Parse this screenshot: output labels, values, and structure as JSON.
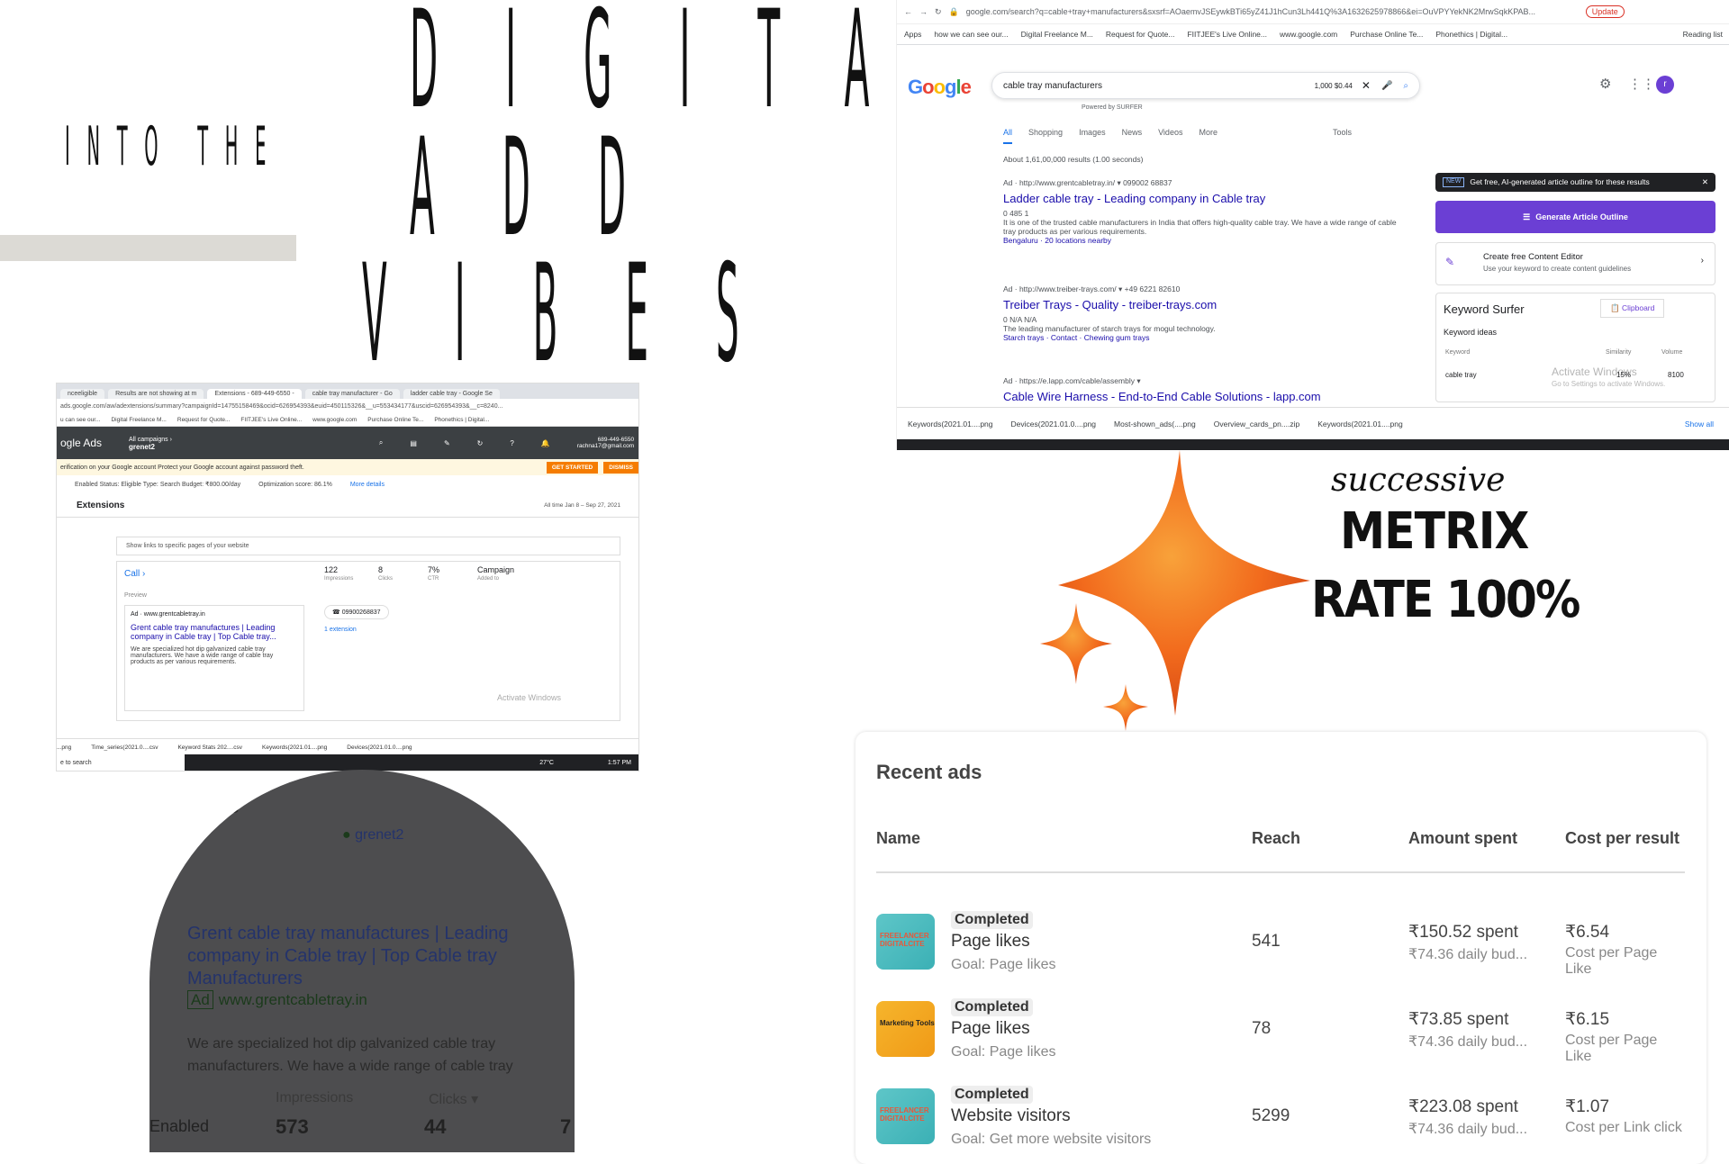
{
  "title": {
    "into": "INTO THE",
    "digital": "DIGITAL",
    "add": "ADD",
    "vibes": "VIBES"
  },
  "google": {
    "url": "google.com/search?q=cable+tray+manufacturers&sxsrf=AOaemvJSEywkBTi65yZ41J1hCun3Lh441Q%3A1632625978866&ei=OuVPYYekNK2MrwSqkKPAB...",
    "bookmarks": [
      "Apps",
      "how we can see our...",
      "Digital Freelance M...",
      "Request for Quote...",
      "FIITJEE's Live Online...",
      "www.google.com",
      "Purchase Online Te...",
      "Phonethics | Digital...",
      "Reading list"
    ],
    "logo": "Google",
    "query": "cable tray manufacturers",
    "query_stats": "1,000  $0.44",
    "powered_by": "Powered by  SURFER",
    "tabs": [
      "All",
      "Shopping",
      "Images",
      "News",
      "Videos",
      "More",
      "Tools"
    ],
    "results_count": "About 1,61,00,000 results (1.00 seconds)",
    "results": [
      {
        "ad": "Ad · http://www.grentcabletray.in/ ▾  099002 68837",
        "title": "Ladder cable tray - Leading company in Cable tray",
        "meta": "0   485   1",
        "desc": "It is one of the trusted cable manufacturers in India that offers high-quality cable tray. We have a wide range of cable tray products as per various requirements.",
        "links": "Bengaluru · 20 locations nearby"
      },
      {
        "ad": "Ad · http://www.treiber-trays.com/ ▾  +49 6221 82610",
        "title": "Treiber Trays - Quality - treiber-trays.com",
        "meta": "0   N/A   N/A",
        "desc": "The leading manufacturer of starch trays for mogul technology.",
        "links": "Starch trays · Contact · Chewing gum trays"
      },
      {
        "ad": "Ad · https://e.lapp.com/cable/assembly ▾",
        "title": "Cable Wire Harness - End-to-End Cable Solutions - lapp.com"
      }
    ],
    "side": {
      "new_badge": "NEW",
      "promo": "Get free, AI-generated article outline for these results",
      "generate_btn": "Generate Article Outline",
      "editor_title": "Create free Content Editor",
      "editor_sub": "Use your keyword to create content guidelines",
      "ks_title": "Keyword Surfer",
      "clipboard": "Clipboard",
      "ideas": "Keyword ideas",
      "col_keyword": "Keyword",
      "col_similarity": "Similarity",
      "col_volume": "Volume",
      "row_keyword": "cable tray",
      "row_similarity": "15%",
      "row_volume": "8100",
      "activate": "Activate Windows",
      "activate_sub": "Go to Settings to activate Windows."
    },
    "downloads": [
      "Keywords(2021.01....png",
      "Devices(2021.01.0....png",
      "Most-shown_ads(....png",
      "Overview_cards_pn....zip",
      "Keywords(2021.01....png",
      "Show all"
    ]
  },
  "ads_shot": {
    "tabs": [
      "nceeligible",
      "Results are not showing at m",
      "Extensions - 689-449-6550 -",
      "cable tray manufacturer - Go",
      "ladder cable tray - Google Se"
    ],
    "url": "ads.google.com/aw/adextensions/summary?campaignId=14755158469&ocid=626954393&euid=450115326&__u=553434177&uscid=626954393&__c=8240...",
    "bookmarks": [
      "u can see our...",
      "Digital Freelance M...",
      "Request for Quote...",
      "FIITJEE's Live Online...",
      "www.google.com",
      "Purchase Online Te...",
      "Phonethics | Digital..."
    ],
    "app": "ogle Ads",
    "all_campaigns": "All campaigns ›",
    "account": "grenet2",
    "header_icons": [
      "SEARCH",
      "REPORTS",
      "TOOLS & SETTINGS",
      "REFRESH",
      "HELP",
      "NOTIFICATIONS"
    ],
    "email": "rachna17@gmail.com",
    "acct_id": "689-449-6550",
    "notice": "erification on your Google account  Protect your Google account against password theft.",
    "get_started": "GET STARTED",
    "dismiss": "DISMISS",
    "status": "Enabled   Status: Eligible   Type: Search   Budget: ₹800.00/day",
    "opt_score": "Optimization score: 86.1%",
    "more_details": "More details",
    "section": "Extensions",
    "date_range": "All time   Jan 8 – Sep 27, 2021",
    "note": "Show links to specific pages of your website",
    "call": "Call ›",
    "impr": "122",
    "impr_l": "Impressions",
    "clicks": "8",
    "clicks_l": "Clicks",
    "ctr": "7%",
    "ctr_l": "CTR",
    "campaign": "Campaign",
    "campaign_l": "Added to",
    "preview": "Preview",
    "ad_url": "Ad · www.grentcabletray.in",
    "ad_title": "Grent cable tray manufactures | Leading company in Cable tray | Top Cable tray...",
    "ad_desc": "We are specialized hot dip galvanized cable tray manufacturers. We have a wide range of cable tray products as per various requirements.",
    "phone": "09900268837",
    "ext": "1 extension",
    "activate": "Activate Windows",
    "downloads": [
      "...png",
      "Time_series(2021.0....csv",
      "Keyword Stats 202....csv",
      "Keywords(2021.01....png",
      "Devices(2021.01.0....png"
    ],
    "search": "e to search",
    "temp": "27°C",
    "clock": "1:57 PM"
  },
  "arch": {
    "top": "ds",
    "account": "grenet2",
    "title": "Grent cable tray manufactures | Leading company in Cable tray | Top Cable tray Manufacturers",
    "ad": "Ad",
    "url": "www.grentcabletray.in",
    "desc": "We are specialized hot dip galvanized cable tray manufacturers. We have a wide range of cable tray",
    "impr_label": "Impressions",
    "clicks_label": "Clicks",
    "status": "Enabled",
    "impr": "573",
    "clicks": "44",
    "ctr_partial": "7"
  },
  "metrix": {
    "successive": "successive",
    "metrix": "METRIX",
    "rate": "RATE 100%"
  },
  "recent_ads": {
    "title": "Recent ads",
    "headers": [
      "Name",
      "Reach",
      "Amount spent",
      "Cost per result"
    ],
    "rows": [
      {
        "status": "Completed",
        "name": "Page likes",
        "goal": "Goal: Page likes",
        "reach": "541",
        "spent": "₹150.52 spent",
        "budget": "₹74.36 daily bud...",
        "cost": "₹6.54",
        "cost_label": "Cost per Page Like",
        "thumb": "FREELANCER DIGITALCITE"
      },
      {
        "status": "Completed",
        "name": "Page likes",
        "goal": "Goal: Page likes",
        "reach": "78",
        "spent": "₹73.85 spent",
        "budget": "₹74.36 daily bud...",
        "cost": "₹6.15",
        "cost_label": "Cost per Page Like",
        "thumb": "Marketing Tools"
      },
      {
        "status": "Completed",
        "name": "Website visitors",
        "goal": "Goal: Get more website visitors",
        "reach": "5299",
        "spent": "₹223.08 spent",
        "budget": "₹74.36 daily bud...",
        "cost": "₹1.07",
        "cost_label": "Cost per Link click",
        "thumb": "FREELANCER DIGITALCITE"
      }
    ]
  },
  "colors": {
    "google_blue": "#1a73e8",
    "ad_title": "#1a0dab",
    "surfer_purple": "#6b3fd4",
    "ads_orange": "#f57c00",
    "arch_gray": "#4d4d4f",
    "spark_orange": "#f26b1d"
  }
}
